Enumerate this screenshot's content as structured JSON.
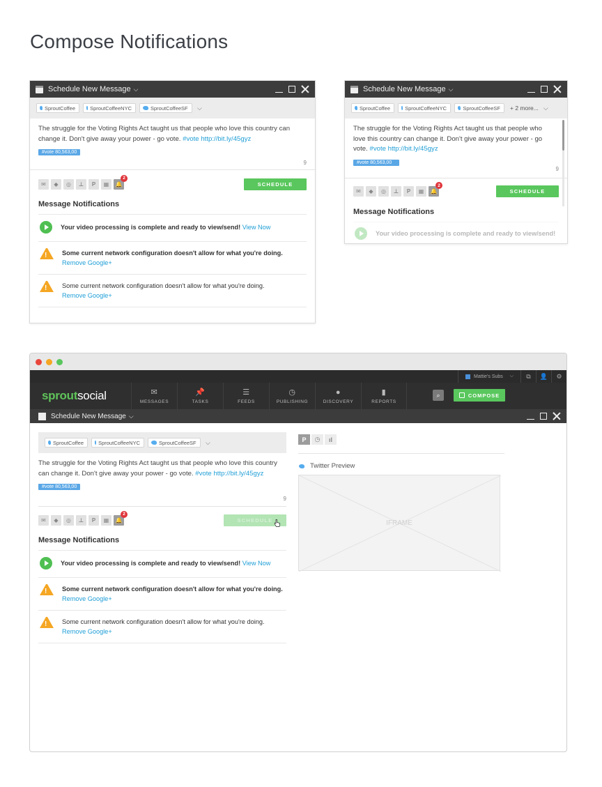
{
  "page_title": "Compose Notifications",
  "window": {
    "title": "Schedule New Message",
    "caret": "⌵",
    "profiles": [
      "SproutCoffee",
      "SproutCoffeeNYC",
      "SproutCoffeeSF"
    ],
    "more_label": "+ 2 more...",
    "message_text": "The struggle for the Voting Rights Act taught us that people who love this country can change it. Don't give away your power - go vote.",
    "message_hashtag": "#vote",
    "message_link": "http://bit.ly/45gyz",
    "tag_label": "#vote 80,563,00",
    "char_count": "9",
    "schedule_label": "SCHEDULE",
    "badge_count": "2",
    "tool_icons": [
      "envelope-icon",
      "tag-icon",
      "target-icon",
      "stamp-icon",
      "pinterest-icon",
      "calendar-icon",
      "bell-icon"
    ],
    "notifications_title": "Message Notifications",
    "notifications": [
      {
        "type": "success",
        "text": "Your video processing is complete and ready to view/send!",
        "link": "View Now",
        "bold": true
      },
      {
        "type": "warning",
        "text": "Some current network configuration doesn't allow for what you're doing.",
        "link": "Remove Google+",
        "bold": true
      },
      {
        "type": "warning",
        "text": "Some current network configuration doesn't allow for what you're doing.",
        "link": "Remove Google+",
        "bold": false
      }
    ]
  },
  "app": {
    "account_name": "Mattie's Subs",
    "logo_sprout": "sprout",
    "logo_social": "social",
    "nav": [
      {
        "label": "MESSAGES",
        "icon": "envelope-icon"
      },
      {
        "label": "TASKS",
        "icon": "pin-icon"
      },
      {
        "label": "FEEDS",
        "icon": "list-icon"
      },
      {
        "label": "PUBLISHING",
        "icon": "clock-icon"
      },
      {
        "label": "DISCOVERY",
        "icon": "person-icon"
      },
      {
        "label": "REPORTS",
        "icon": "bars-icon"
      }
    ],
    "compose_label": "COMPOSE",
    "twitter_preview_label": "Twitter Preview",
    "iframe_label": "IFRAME"
  },
  "colors": {
    "brand_green": "#59c75d",
    "link_blue": "#1f9ed6",
    "warning": "#f5a623",
    "badge_red": "#e0353b"
  }
}
